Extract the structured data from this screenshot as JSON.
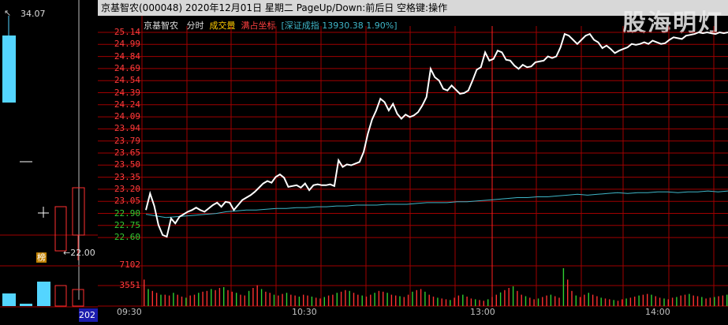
{
  "titlebar": {
    "text": "京基智农(000048)  2020年12月01日 星期二 PageUp/Down:前后日 空格键:操作"
  },
  "watermark": "股海明灯",
  "legend": {
    "name": "京基智农",
    "mode": "分时",
    "volume_label": "成交量",
    "coord_label": "满占坐标",
    "index_label": "[深证成指 13930.38 1.90%]"
  },
  "left_panel": {
    "high_label": "34.07",
    "low_label": "22.00",
    "badge": "榜",
    "bottom_label": "202"
  },
  "price_axis": [
    "25.14",
    "24.99",
    "24.84",
    "24.69",
    "24.54",
    "24.39",
    "24.24",
    "24.09",
    "23.94",
    "23.79",
    "23.65",
    "23.50",
    "23.35",
    "23.20",
    "23.05",
    "22.90",
    "22.75",
    "22.60"
  ],
  "volume_axis": [
    "7102",
    "3551"
  ],
  "time_axis": [
    "09:30",
    "10:30",
    "13:00",
    "14:00"
  ],
  "colors": {
    "grid": "#a00000",
    "price_line": "#ffffff",
    "index_line": "#3fb6c8",
    "up_label": "#ff3c3c",
    "down_label": "#33cc33",
    "vol_up": "#ff3030",
    "vol_down": "#30d030"
  },
  "chart_data": {
    "type": "line",
    "price": [
      23.0,
      23.2,
      23.05,
      22.82,
      22.7,
      22.68,
      22.9,
      22.84,
      22.92,
      22.95,
      22.98,
      23.0,
      23.03,
      23.0,
      22.98,
      23.02,
      23.06,
      23.09,
      23.04,
      23.1,
      23.09,
      23.0,
      23.06,
      23.12,
      23.15,
      23.18,
      23.22,
      23.27,
      23.32,
      23.35,
      23.33,
      23.4,
      23.43,
      23.39,
      23.28,
      23.29,
      23.3,
      23.27,
      23.32,
      23.24,
      23.3,
      23.31,
      23.3,
      23.3,
      23.31,
      23.29,
      23.6,
      23.52,
      23.55,
      23.54,
      23.56,
      23.58,
      23.7,
      23.92,
      24.09,
      24.2,
      24.34,
      24.3,
      24.2,
      24.28,
      24.16,
      24.1,
      24.15,
      24.12,
      24.14,
      24.18,
      24.26,
      24.36,
      24.7,
      24.6,
      24.56,
      24.46,
      24.44,
      24.5,
      24.45,
      24.4,
      24.41,
      24.44,
      24.56,
      24.69,
      24.72,
      24.9,
      24.8,
      24.82,
      24.92,
      24.9,
      24.81,
      24.8,
      24.74,
      24.7,
      24.75,
      24.72,
      24.73,
      24.78,
      24.79,
      24.8,
      24.85,
      24.83,
      24.85,
      24.96,
      25.12,
      25.1,
      25.05,
      25.0,
      25.05,
      25.1,
      25.12,
      25.05,
      25.02,
      24.95,
      24.98,
      24.94,
      24.89,
      24.92,
      24.94,
      24.96,
      25.0,
      24.99,
      25.0,
      25.02,
      25.0,
      25.04,
      25.02,
      25.0,
      25.01,
      25.05,
      25.08,
      25.07,
      25.06,
      25.1,
      25.11,
      25.12,
      25.14,
      25.13,
      25.14,
      25.13,
      25.12,
      25.14,
      25.13,
      25.14
    ],
    "index": [
      22.95,
      22.93,
      22.91,
      22.92,
      22.93,
      22.94,
      22.95,
      22.96,
      22.98,
      22.99,
      23.0,
      23.0,
      23.01,
      23.02,
      23.02,
      23.03,
      23.03,
      23.04,
      23.04,
      23.05,
      23.05,
      23.06,
      23.06,
      23.06,
      23.07,
      23.07,
      23.07,
      23.08,
      23.09,
      23.09,
      23.09,
      23.1,
      23.1,
      23.11,
      23.12,
      23.13,
      23.14,
      23.15,
      23.15,
      23.16,
      23.16,
      23.17,
      23.18,
      23.19,
      23.18,
      23.19,
      23.2,
      23.21,
      23.2,
      23.21,
      23.21,
      23.22,
      23.22,
      23.21,
      23.22,
      23.22,
      23.23,
      23.22,
      23.23
    ],
    "volume": [
      70,
      45,
      40,
      35,
      30,
      30,
      28,
      35,
      30,
      25,
      22,
      28,
      30,
      35,
      38,
      40,
      45,
      42,
      48,
      50,
      42,
      38,
      35,
      30,
      28,
      40,
      48,
      55,
      45,
      38,
      35,
      30,
      28,
      32,
      35,
      30,
      28,
      25,
      30,
      28,
      25,
      22,
      20,
      24,
      28,
      30,
      35,
      38,
      42,
      40,
      35,
      30,
      28,
      25,
      30,
      35,
      40,
      38,
      35,
      30,
      28,
      26,
      24,
      30,
      38,
      42,
      45,
      38,
      30,
      25,
      22,
      20,
      18,
      16,
      22,
      28,
      30,
      25,
      20,
      18,
      16,
      14,
      18,
      24,
      30,
      36,
      42,
      48,
      52,
      40,
      30,
      26,
      22,
      18,
      20,
      24,
      28,
      30,
      26,
      22,
      100,
      70,
      40,
      28,
      24,
      30,
      35,
      30,
      26,
      22,
      20,
      18,
      16,
      14,
      18,
      20,
      22,
      25,
      28,
      30,
      32,
      30,
      26,
      22,
      20,
      18,
      22,
      24,
      28,
      30,
      32,
      28,
      26,
      24,
      20,
      22,
      24,
      26,
      28,
      30
    ],
    "ylim": [
      22.53,
      25.21
    ],
    "vol_max": 7102
  }
}
